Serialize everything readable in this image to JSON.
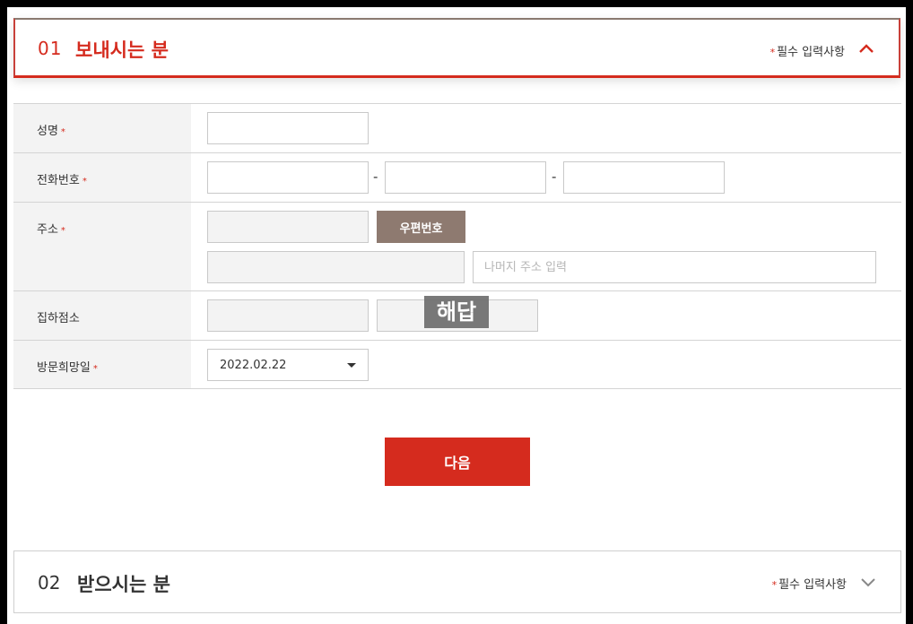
{
  "sender": {
    "number": "01",
    "title": "보내시는 분",
    "required_star": "*",
    "required_note": "필수 입력사항",
    "collapse_icon": "chevron-up-icon"
  },
  "form": {
    "name": {
      "label": "성명",
      "star": "*",
      "value": ""
    },
    "phone": {
      "label": "전화번호",
      "star": "*",
      "separator": "-",
      "part1": "",
      "part2": "",
      "part3": ""
    },
    "address": {
      "label": "주소",
      "star": "*",
      "zipcode": "",
      "zip_button": "우편번호",
      "address1": "",
      "address2_placeholder": "나머지 주소 입력"
    },
    "pickup": {
      "label": "집하점소",
      "field1": "",
      "field2": ""
    },
    "visit_date": {
      "label": "방문희망일",
      "star": "*",
      "value": "2022.02.22"
    }
  },
  "watermark": "해답",
  "next_button": "다음",
  "receiver": {
    "number": "02",
    "title": "받으시는 분",
    "required_star": "*",
    "required_note": "필수 입력사항",
    "expand_icon": "chevron-down-icon"
  }
}
